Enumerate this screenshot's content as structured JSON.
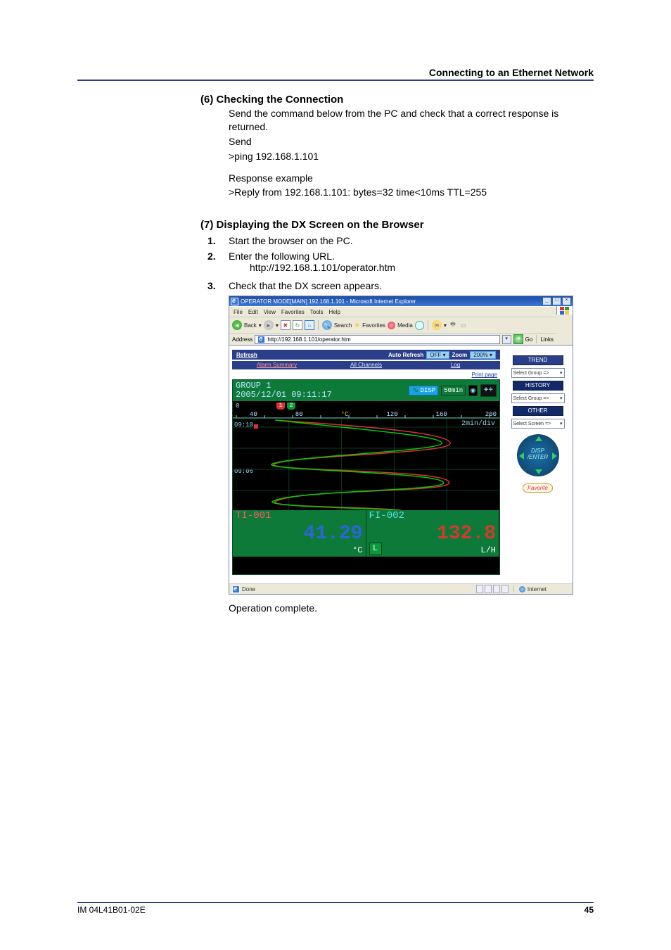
{
  "header": {
    "title": "Connecting to an Ethernet Network"
  },
  "sec6": {
    "title": "(6) Checking the Connection",
    "line1": "Send the command below from the PC and check that a correct response is returned.",
    "send_lbl": "Send",
    "send_cmd": ">ping 192.168.1.101",
    "resp_lbl": "Response example",
    "resp_txt": ">Reply from 192.168.1.101: bytes=32 time<10ms TTL=255"
  },
  "sec7": {
    "title": "(7) Displaying the DX Screen on the Browser",
    "steps": {
      "n1": "1.",
      "t1": "Start the browser on the PC.",
      "n2": "2.",
      "t2": "Enter the following URL.",
      "t2b": "http://192.168.1.101/operator.htm",
      "n3": "3.",
      "t3": "Check that the DX screen appears."
    }
  },
  "ie": {
    "title": "OPERATOR MODE[MAIN] 192.168.1.101 - Microsoft Internet Explorer",
    "menu": {
      "file": "File",
      "edit": "Edit",
      "view": "View",
      "fav": "Favorites",
      "tools": "Tools",
      "help": "Help"
    },
    "tb": {
      "back": "Back",
      "search": "Search",
      "fav": "Favorites",
      "media": "Media"
    },
    "addr_label": "Address",
    "url": "http://192.168.1.101/operator.htm",
    "go": "Go",
    "links": "Links",
    "status_done": "Done",
    "status_zone": "Internet"
  },
  "dx": {
    "refresh": "Refresh",
    "auto_refresh": "Auto Refresh",
    "auto_refresh_val": "OFF",
    "zoom": "Zoom",
    "zoom_val": "200%",
    "tabs": {
      "alarm": "Alarm Summary",
      "all": "All Channels",
      "log": "Log"
    },
    "print": "Print page",
    "group_name": "GROUP 1",
    "group_ts": "2005/12/01 09:11:17",
    "disp": "DISP",
    "span": "50min",
    "cam_icon": "◉",
    "frac": "+÷",
    "scale": {
      "s0": "0",
      "s40": "40",
      "s80": "80",
      "unit": "°C",
      "s120": "120",
      "s160": "160",
      "s200": "200"
    },
    "flags": {
      "f1": "1",
      "f2": "2"
    },
    "timediv": "2min/div",
    "t1": "09:10",
    "t2": "09:06",
    "ch1_name": "TI-001",
    "ch1_val": "41.29",
    "ch1_unit": "°C",
    "ch2_name": "FI-002",
    "ch2_val": "132.8",
    "ch2_unit": "L/H",
    "Lmark": "L",
    "side": {
      "trend": "TREND",
      "history": "HISTORY",
      "other": "OTHER",
      "selgroup": "Select Group =>",
      "selscreen": "Select Screen =>",
      "favorite": "Favorite"
    }
  },
  "closing": "Operation complete.",
  "footer": {
    "left": "IM 04L41B01-02E",
    "right": "45"
  }
}
